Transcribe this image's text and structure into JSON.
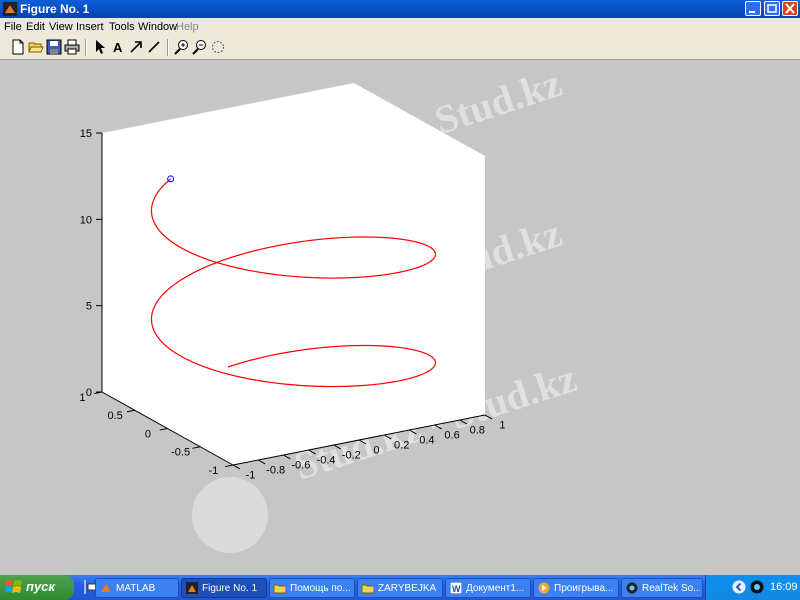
{
  "window": {
    "title": "Figure No. 1"
  },
  "menu": {
    "items": [
      "File",
      "Edit",
      "View",
      "Insert",
      "Tools",
      "Window",
      "Help"
    ]
  },
  "toolbar": {
    "tools": [
      "new-icon",
      "open-icon",
      "save-icon",
      "print-icon",
      "select-arrow-icon",
      "text-icon",
      "arrow-icon",
      "line-icon",
      "zoom-in-icon",
      "zoom-out-icon",
      "rotate-3d-icon"
    ]
  },
  "chart_data": {
    "type": "line",
    "projection": "3d",
    "curve": "helix",
    "x": "sin(t)",
    "y": "cos(t)",
    "z": "t",
    "t_range": [
      0,
      12
    ],
    "end_marker": "circle",
    "line_color": "#ff0000",
    "marker_color": "#0000ff",
    "axes": {
      "x": {
        "lim": [
          -1,
          1
        ],
        "ticks": [
          "-1",
          "-0.8",
          "-0.6",
          "-0.4",
          "-0.2",
          "0",
          "0.2",
          "0.4",
          "0.6",
          "0.8",
          "1"
        ]
      },
      "y": {
        "lim": [
          -1,
          1
        ],
        "ticks": [
          "-1",
          "-0.5",
          "0",
          "0.5",
          "1"
        ]
      },
      "z": {
        "lim": [
          0,
          15
        ],
        "ticks": [
          "0",
          "5",
          "10",
          "15"
        ]
      }
    },
    "grid": false,
    "title": "",
    "xlabel": "",
    "ylabel": "",
    "zlabel": ""
  },
  "watermark": {
    "text": "Stud.kz - Stud.kz"
  },
  "taskbar": {
    "start_label": "пуск",
    "buttons": [
      {
        "label": "MATLAB",
        "icon": "matlab-icon",
        "active": false
      },
      {
        "label": "Figure No. 1",
        "icon": "figure-icon",
        "active": true
      },
      {
        "label": "Помощь по...",
        "icon": "folder-icon",
        "active": false
      },
      {
        "label": "ZARYBEJKA",
        "icon": "folder-icon",
        "active": false
      },
      {
        "label": "Документ1...",
        "icon": "word-icon",
        "active": false
      },
      {
        "label": "Проигрыва...",
        "icon": "media-player-icon",
        "active": false
      },
      {
        "label": "RealTek So...",
        "icon": "realtek-icon",
        "active": false
      }
    ],
    "clock": "16:09"
  }
}
